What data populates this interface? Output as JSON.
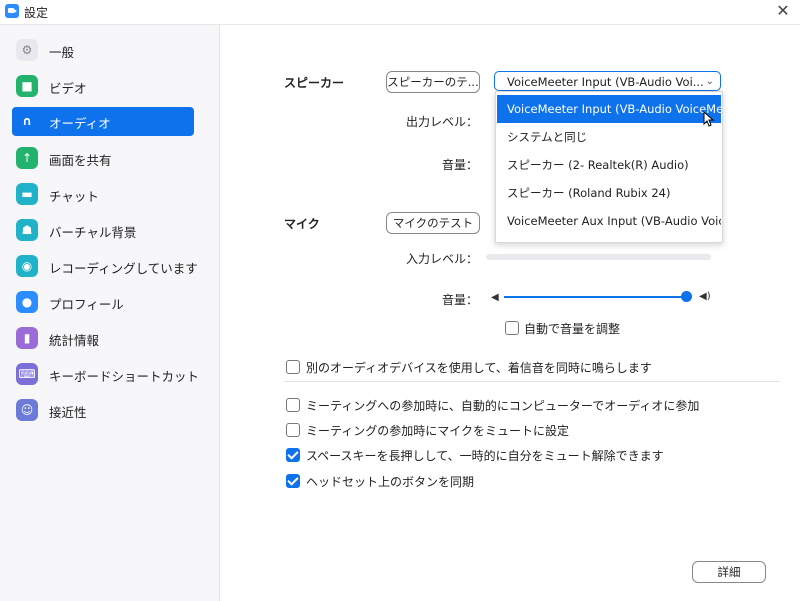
{
  "window": {
    "title": "設定"
  },
  "sidebar": {
    "items": [
      {
        "label": "一般",
        "icon": "gear-icon",
        "color": "#e8e8ee",
        "glyph": "⚙",
        "active": false
      },
      {
        "label": "ビデオ",
        "icon": "video-camera-icon",
        "color": "#23b36f",
        "glyph": "■",
        "active": false
      },
      {
        "label": "オーディオ",
        "icon": "headphones-icon",
        "color": "#0e72ed",
        "glyph": "∩",
        "active": true
      },
      {
        "label": "画面を共有",
        "icon": "share-screen-icon",
        "color": "#23b36f",
        "glyph": "↑",
        "active": false
      },
      {
        "label": "チャット",
        "icon": "chat-bubble-icon",
        "color": "#20b2c8",
        "glyph": "▬",
        "active": false
      },
      {
        "label": "バーチャル背景",
        "icon": "virtual-background-icon",
        "color": "#20b2c8",
        "glyph": "☗",
        "active": false
      },
      {
        "label": "レコーディングしています",
        "icon": "record-icon",
        "color": "#20b2c8",
        "glyph": "◉",
        "active": false
      },
      {
        "label": "プロフィール",
        "icon": "profile-icon",
        "color": "#2d8cff",
        "glyph": "●",
        "active": false
      },
      {
        "label": "統計情報",
        "icon": "statistics-icon",
        "color": "#9b6bd8",
        "glyph": "▮",
        "active": false
      },
      {
        "label": "キーボードショートカット",
        "icon": "keyboard-icon",
        "color": "#7b6fd8",
        "glyph": "⌨",
        "active": false
      },
      {
        "label": "接近性",
        "icon": "accessibility-icon",
        "color": "#6c7bd8",
        "glyph": "☺",
        "active": false
      }
    ]
  },
  "audio": {
    "speaker_label": "スピーカー",
    "speaker_test_button": "スピーカーのテ...",
    "speaker_device_selected": "VoiceMeeter Input (VB-Audio Voi...",
    "speaker_dropdown_options": [
      "VoiceMeeter Input (VB-Audio VoiceMe...",
      "システムと同じ",
      "スピーカー (2- Realtek(R) Audio)",
      "スピーカー (Roland Rubix 24)",
      "VoiceMeeter Aux Input (VB-Audio Voic..."
    ],
    "output_level_label": "出力レベル：",
    "speaker_volume_label": "音量：",
    "mic_label": "マイク",
    "mic_test_button": "マイクのテスト",
    "input_level_label": "入力レベル：",
    "mic_volume_label": "音量：",
    "mic_volume_value": 1.0,
    "auto_adjust_label": "自動で音量を調整",
    "auto_adjust_checked": false
  },
  "options": [
    {
      "label": "別のオーディオデバイスを使用して、着信音を同時に鳴らします",
      "checked": false
    },
    {
      "label": "ミーティングへの参加時に、自動的にコンピューターでオーディオに参加",
      "checked": false
    },
    {
      "label": "ミーティングの参加時にマイクをミュートに設定",
      "checked": false
    },
    {
      "label": "スペースキーを長押しして、一時的に自分をミュート解除できます",
      "checked": true
    },
    {
      "label": "ヘッドセット上のボタンを同期",
      "checked": true
    }
  ],
  "details_button": "詳細",
  "colors": {
    "accent": "#0e72ed"
  }
}
